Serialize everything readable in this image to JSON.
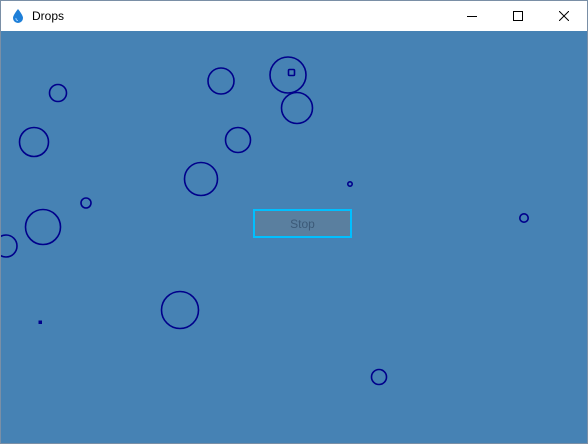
{
  "window": {
    "title": "Drops",
    "icon": "water-drop-icon",
    "controls": [
      "minimize-icon",
      "maximize-icon",
      "close-icon"
    ]
  },
  "canvas": {
    "background_color": "#4682b4",
    "drop_color": "#00008b"
  },
  "stop_button": {
    "label": "Stop",
    "border_color": "#00bfff"
  }
}
